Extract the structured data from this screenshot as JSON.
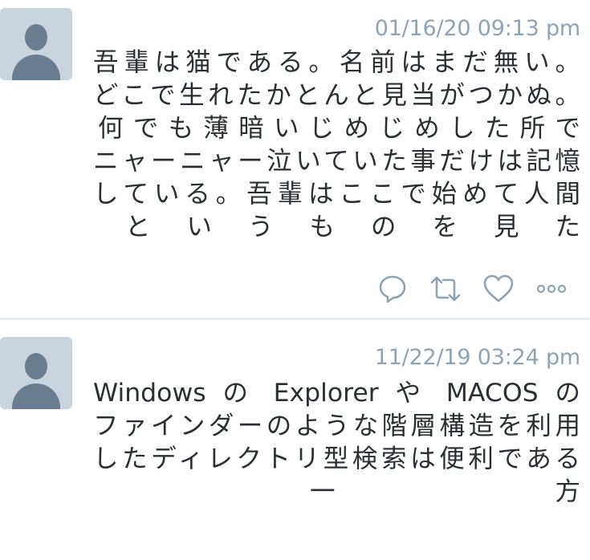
{
  "feed": {
    "tweets": [
      {
        "timestamp": "01/16/20 09:13 pm",
        "lines": [
          "吾輩は猫である。名前はまだ無い。",
          "どこで生れたかとんと見当がつかぬ。",
          "何でも薄暗いじめじめした所で",
          "ニャーニャー泣いていた事だけは記憶",
          "している。吾輩はここで始めて人間",
          "というものを見た"
        ],
        "actions": [
          {
            "name": "reply",
            "icon": "speech-bubble-icon"
          },
          {
            "name": "retweet",
            "icon": "retweet-icon"
          },
          {
            "name": "like",
            "icon": "heart-icon"
          },
          {
            "name": "more",
            "icon": "more-dots-icon"
          }
        ]
      },
      {
        "timestamp": "11/22/19 03:24 pm",
        "lines": [
          "Windows の Explorer や MACOS の",
          "ファインダーのような階層構造を利用",
          "したディレクトリ型検索は便利である",
          "一方"
        ]
      }
    ]
  },
  "colors": {
    "text": "#2b2f33",
    "timestamp": "#8fa3b3",
    "icon": "#8fa3b3",
    "avatar_bg": "#c9d4dd",
    "avatar_fg": "#687d8f",
    "divider": "#e6ecf0"
  }
}
